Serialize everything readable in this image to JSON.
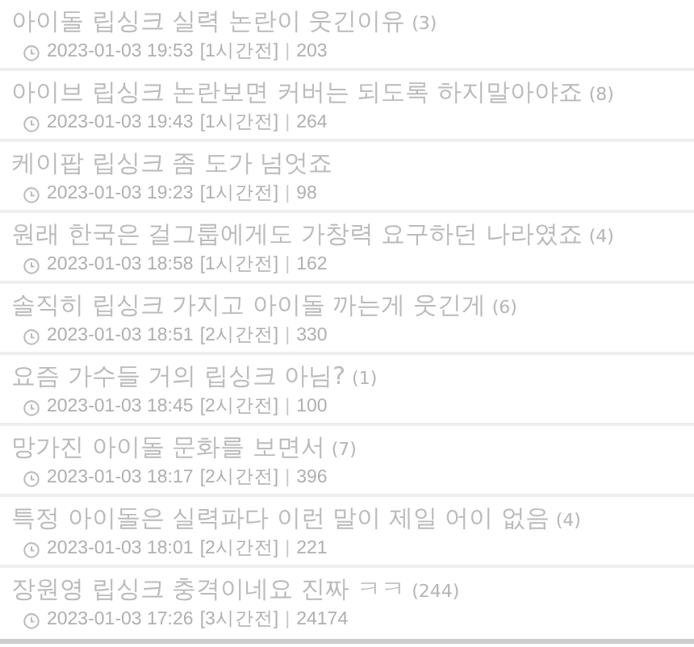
{
  "posts": [
    {
      "title": "아이돌 립싱크 실력 논란이 웃긴이유",
      "comments": "(3)",
      "date": "2023-01-03 19:53",
      "ago": "[1시간전]",
      "separator": "|",
      "views": "203"
    },
    {
      "title": "아이브 립싱크 논란보면 커버는 되도록 하지말아야죠",
      "comments": "(8)",
      "date": "2023-01-03 19:43",
      "ago": "[1시간전]",
      "separator": "|",
      "views": "264"
    },
    {
      "title": "케이팝 립싱크 좀 도가 넘엇죠",
      "date": "2023-01-03 19:23",
      "ago": "[1시간전]",
      "separator": "|",
      "views": "98"
    },
    {
      "title": "원래 한국은 걸그룹에게도 가창력 요구하던 나라였죠",
      "comments": "(4)",
      "date": "2023-01-03 18:58",
      "ago": "[1시간전]",
      "separator": "|",
      "views": "162"
    },
    {
      "title": "솔직히 립싱크 가지고 아이돌 까는게 웃긴게",
      "comments": "(6)",
      "date": "2023-01-03 18:51",
      "ago": "[2시간전]",
      "separator": "|",
      "views": "330"
    },
    {
      "title": "요즘 가수들 거의 립싱크 아님?",
      "comments": "(1)",
      "date": "2023-01-03 18:45",
      "ago": "[2시간전]",
      "separator": "|",
      "views": "100"
    },
    {
      "title": "망가진 아이돌 문화를 보면서",
      "comments": "(7)",
      "date": "2023-01-03 18:17",
      "ago": "[2시간전]",
      "separator": "|",
      "views": "396"
    },
    {
      "title": "특정 아이돌은 실력파다 이런 말이 제일 어이 없음",
      "comments": "(4)",
      "date": "2023-01-03 18:01",
      "ago": "[2시간전]",
      "separator": "|",
      "views": "221"
    },
    {
      "title": "장원영 립싱크 충격이네요 진짜 ㅋㅋ",
      "comments": "(244)",
      "date": "2023-01-03 17:26",
      "ago": "[3시간전]",
      "separator": "|",
      "views": "24174"
    }
  ]
}
